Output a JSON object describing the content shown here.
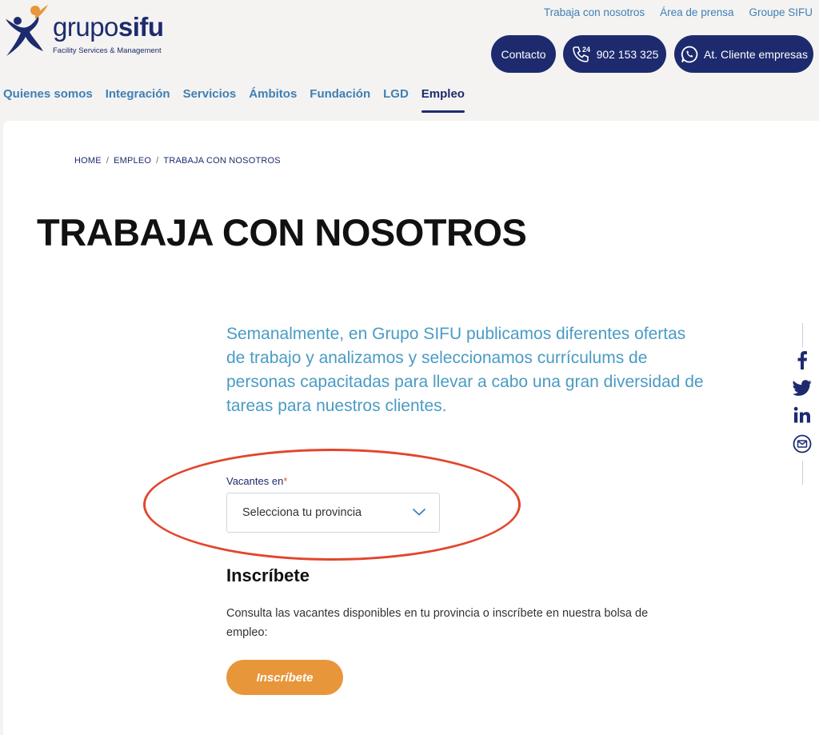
{
  "brand": {
    "name_part1": "grupo",
    "name_part2": "sifu",
    "tagline": "Facility Services & Management"
  },
  "top_links": [
    "Trabaja con nosotros",
    "Área de prensa",
    "Groupe SIFU"
  ],
  "header_buttons": {
    "contact": "Contacto",
    "phone_badge": "24",
    "phone": "902 153 325",
    "whatsapp": "At. Cliente empresas"
  },
  "nav": [
    "Quienes somos",
    "Integración",
    "Servicios",
    "Ámbitos",
    "Fundación",
    "LGD",
    "Empleo"
  ],
  "nav_active": "Empleo",
  "breadcrumb": [
    "HOME",
    "EMPLEO",
    "TRABAJA CON NOSOTROS"
  ],
  "breadcrumb_separator": "/",
  "page": {
    "title": "TRABAJA CON NOSOTROS",
    "intro": "Semanalmente, en Grupo SIFU publicamos diferentes ofertas de trabajo y analizamos y seleccionamos currículums de personas capacitadas para llevar a cabo una gran diversidad de tareas para nuestros clientes.",
    "vacancies_label": "Vacantes en",
    "required_mark": "*",
    "select_placeholder": "Selecciona tu provincia",
    "subscribe_heading": "Inscríbete",
    "subscribe_text": "Consulta las vacantes disponibles en tu provincia o inscríbete en nuestra bolsa de empleo:",
    "subscribe_button": "Inscríbete"
  },
  "share_icons": [
    "facebook-icon",
    "twitter-icon",
    "linkedin-icon",
    "email-icon"
  ],
  "colors": {
    "navy": "#1d2b6e",
    "link_blue": "#3f7fb5",
    "intro_blue": "#4a9bc4",
    "orange": "#e8963a",
    "highlight_red": "#e2462d",
    "background": "#f4f3f1"
  }
}
